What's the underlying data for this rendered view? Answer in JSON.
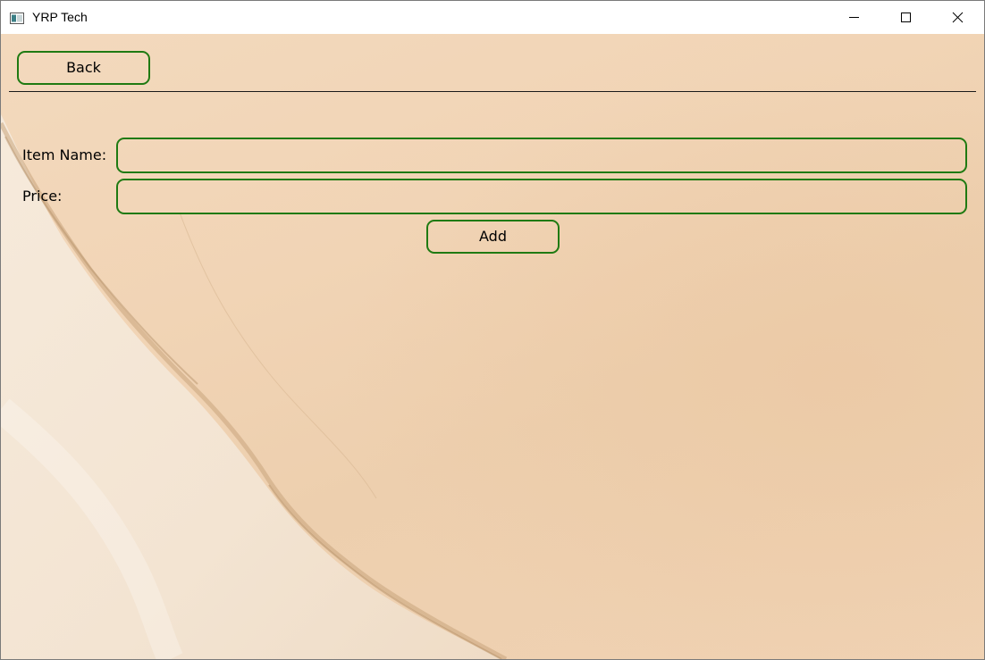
{
  "window": {
    "title": "YRP Tech"
  },
  "titlebar_controls": {
    "icons": [
      "minimize-icon",
      "maximize-icon",
      "close-icon"
    ]
  },
  "toolbar": {
    "back_label": "Back"
  },
  "form": {
    "item_name_label": "Item Name:",
    "item_name_value": "",
    "price_label": "Price:",
    "price_value": "",
    "add_label": "Add"
  },
  "colors": {
    "accent_border": "#1f7a12",
    "background_sand": "#f1d4b5"
  }
}
